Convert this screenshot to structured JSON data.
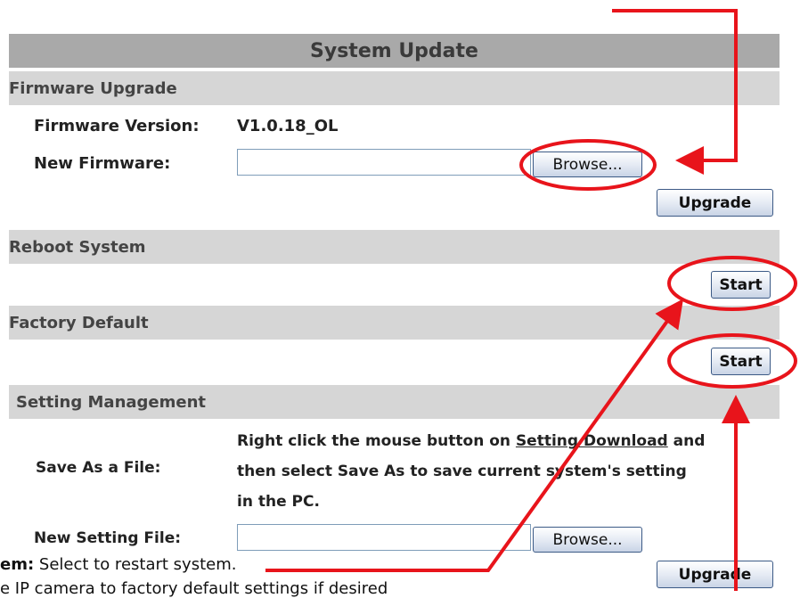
{
  "title": "System Update",
  "firmware": {
    "section_label": "Firmware Upgrade",
    "version_label": "Firmware Version:",
    "version_value": "V1.0.18_OL",
    "new_label": "New Firmware:",
    "browse_label": "Browse...",
    "upgrade_label": "Upgrade"
  },
  "reboot": {
    "section_label": "Reboot System",
    "start_label": "Start"
  },
  "factory": {
    "section_label": "Factory Default",
    "start_label": "Start"
  },
  "settings": {
    "section_label": "Setting Management",
    "save_label": "Save As a File:",
    "save_text_1": "Right click the mouse button on ",
    "save_link": "Setting Download",
    "save_text_2": " and",
    "save_text_3": "then select Save As to save current system's setting",
    "save_text_4": "in the PC.",
    "new_label": "New Setting File:",
    "browse_label": "Browse...",
    "upgrade_label": "Upgrade"
  },
  "captions": {
    "reboot_bold": "em:",
    "reboot_text": " Select to restart system.",
    "factory_text": "e IP camera to factory default settings if desired"
  },
  "colors": {
    "annotation": "#e8141b",
    "header_bar": "#a9a9a9",
    "section_bar": "#d6d6d6"
  }
}
